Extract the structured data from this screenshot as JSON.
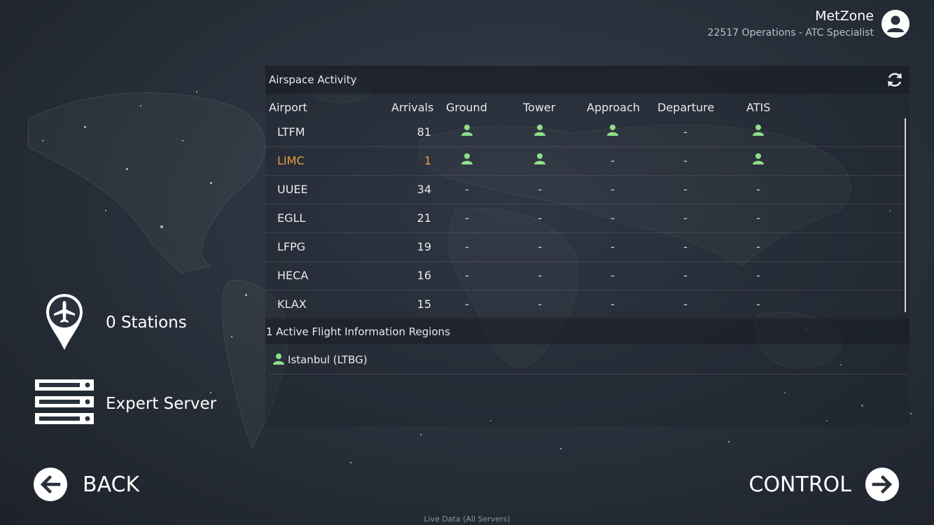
{
  "header": {
    "user_name": "MetZone",
    "user_subtitle": "22517 Operations - ATC Specialist",
    "avatar_icon": "user-avatar-icon"
  },
  "airspace": {
    "title": "Airspace Activity",
    "refresh_icon": "refresh-icon",
    "columns": [
      "Airport",
      "Arrivals",
      "Ground",
      "Tower",
      "Approach",
      "Departure",
      "ATIS"
    ],
    "rows": [
      {
        "airport": "LTFM",
        "arrivals": "81",
        "ground": "staffed",
        "tower": "staffed",
        "approach": "staffed",
        "departure": "-",
        "atis": "staffed",
        "highlight": false
      },
      {
        "airport": "LIMC",
        "arrivals": "1",
        "ground": "staffed",
        "tower": "staffed",
        "approach": "-",
        "departure": "-",
        "atis": "staffed",
        "highlight": true
      },
      {
        "airport": "UUEE",
        "arrivals": "34",
        "ground": "-",
        "tower": "-",
        "approach": "-",
        "departure": "-",
        "atis": "-",
        "highlight": false
      },
      {
        "airport": "EGLL",
        "arrivals": "21",
        "ground": "-",
        "tower": "-",
        "approach": "-",
        "departure": "-",
        "atis": "-",
        "highlight": false
      },
      {
        "airport": "LFPG",
        "arrivals": "19",
        "ground": "-",
        "tower": "-",
        "approach": "-",
        "departure": "-",
        "atis": "-",
        "highlight": false
      },
      {
        "airport": "HECA",
        "arrivals": "16",
        "ground": "-",
        "tower": "-",
        "approach": "-",
        "departure": "-",
        "atis": "-",
        "highlight": false
      },
      {
        "airport": "KLAX",
        "arrivals": "15",
        "ground": "-",
        "tower": "-",
        "approach": "-",
        "departure": "-",
        "atis": "-",
        "highlight": false
      }
    ]
  },
  "fir": {
    "title": "1 Active Flight Information Regions",
    "items": [
      {
        "name": "Istanbul (LTBG)",
        "icon": "person-icon"
      }
    ]
  },
  "sidebar": {
    "stations_label": "0 Stations",
    "stations_icon": "airplane-pin-icon",
    "server_label": "Expert Server",
    "server_icon": "server-icon"
  },
  "nav": {
    "back_label": "BACK",
    "control_label": "CONTROL"
  },
  "footer": {
    "text": "Live Data (All Servers)"
  },
  "colors": {
    "accent_orange": "#e6a040",
    "staffed_green": "#8fe08a",
    "background": "#2a313c"
  }
}
